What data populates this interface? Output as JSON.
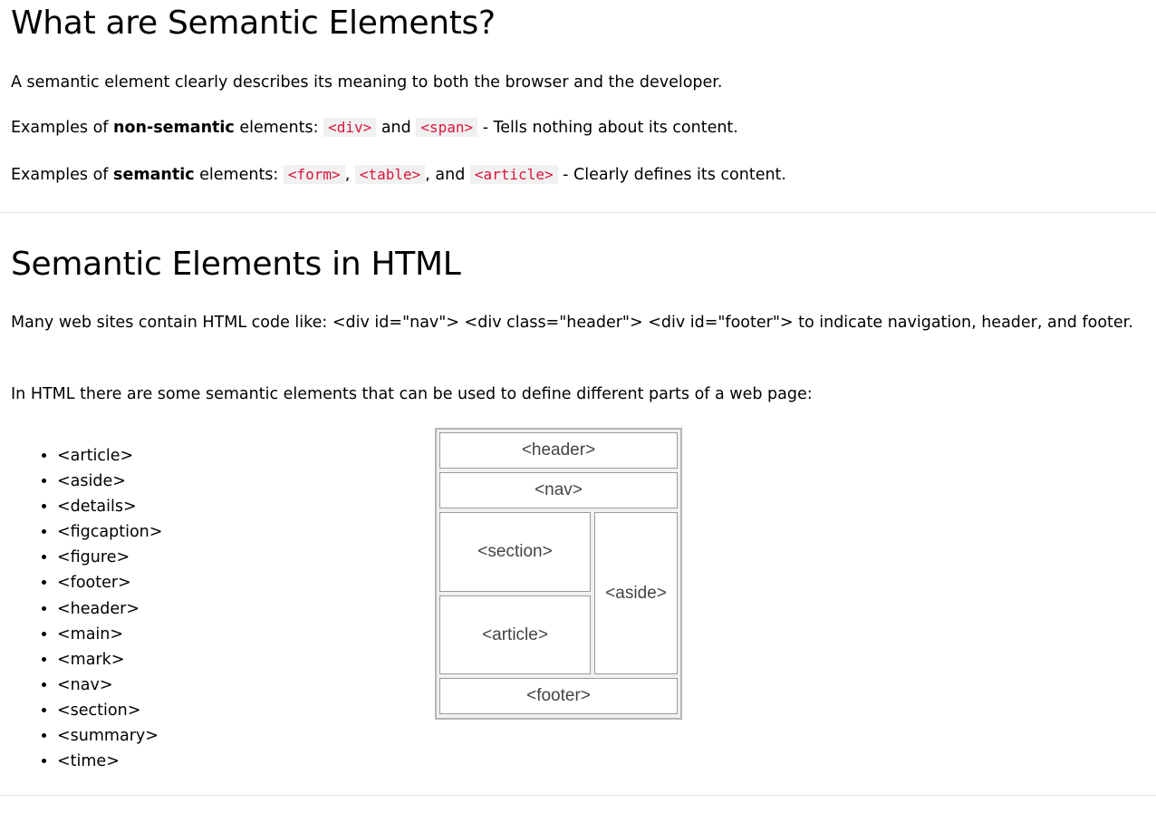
{
  "section1": {
    "title": "What are Semantic Elements?",
    "intro": "A semantic element clearly describes its meaning to both the browser and the developer.",
    "nonsemantic": {
      "prefix": "Examples of ",
      "bold": "non-semantic",
      "mid": " elements: ",
      "code1": "<div>",
      "and": " and ",
      "code2": "<span>",
      "suffix": " - Tells nothing about its content."
    },
    "semantic": {
      "prefix": "Examples of ",
      "bold": "semantic",
      "mid": " elements: ",
      "code1": "<form>",
      "sep1": ", ",
      "code2": "<table>",
      "sep2": ", and ",
      "code3": "<article>",
      "suffix": " - Clearly defines its content."
    }
  },
  "section2": {
    "title": "Semantic Elements in HTML",
    "para1": "Many web sites contain HTML code like: <div id=\"nav\"> <div class=\"header\"> <div id=\"footer\"> to indicate navigation, header, and footer.",
    "para2": "In HTML there are some semantic elements that can be used to define different parts of a web page:",
    "list": [
      "<article>",
      "<aside>",
      "<details>",
      "<figcaption>",
      "<figure>",
      "<footer>",
      "<header>",
      "<main>",
      "<mark>",
      "<nav>",
      "<section>",
      "<summary>",
      "<time>"
    ],
    "diagram": {
      "header": "<header>",
      "nav": "<nav>",
      "section": "<section>",
      "article": "<article>",
      "aside": "<aside>",
      "footer": "<footer>"
    }
  },
  "colors": {
    "code_text": "#dc143c",
    "code_bg": "#f1f1f1",
    "divider": "#e6e6e6"
  }
}
